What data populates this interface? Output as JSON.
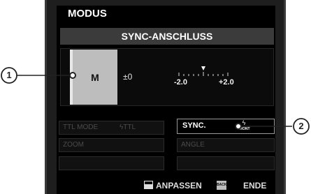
{
  "header": {
    "title": "MODUS"
  },
  "sync": {
    "title": "SYNC-ANSCHLUSS",
    "mode": "M",
    "ev": "±0",
    "scale_left": "-2.0",
    "scale_right": "+2.0"
  },
  "settings": {
    "ttl_mode_label": "TTL MODE",
    "ttl_mode_value": "ϟTTL",
    "zoom_label": "ZOOM",
    "sync_label": "SYNC.",
    "sync_value_bolt": "ϟ",
    "sync_value_text": "FRONT",
    "angle_label": "ANGLE"
  },
  "footer": {
    "adjust_label": "ANPASSEN",
    "back_icon": "BACK",
    "end_label": "ENDE"
  },
  "callouts": [
    "1",
    "2"
  ]
}
